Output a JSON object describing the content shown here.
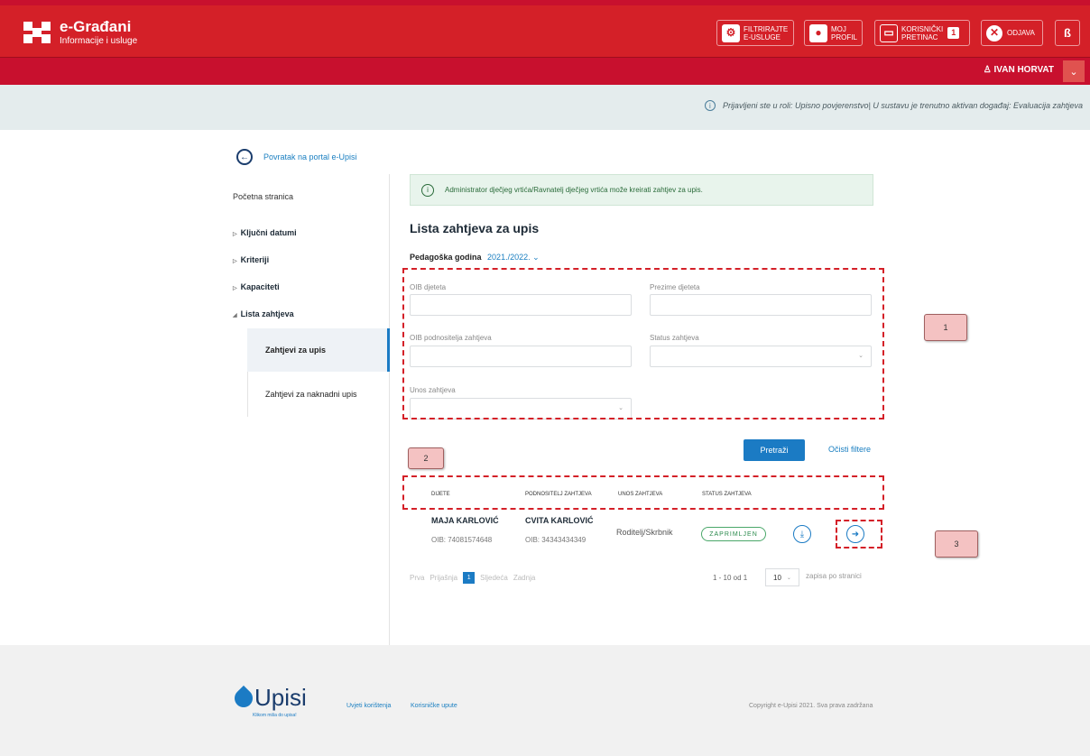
{
  "header": {
    "brand_title": "e-Građani",
    "brand_sub": "Informacije i usluge",
    "btn_filter_l1": "FILTRIRAJTE",
    "btn_filter_l2": "E-USLUGE",
    "btn_profile_l1": "MOJ",
    "btn_profile_l2": "PROFIL",
    "btn_inbox_l1": "KORISNIČKI",
    "btn_inbox_l2": "PRETINAC",
    "inbox_count": "1",
    "btn_logout": "ODJAVA",
    "lang_btn": "ß",
    "user_name": "IVAN HORVAT"
  },
  "infobar": {
    "text": "Prijavljeni ste u roli: Upisno povjerenstvo| U sustavu je trenutno aktivan događaj: Evaluacija zahtjeva"
  },
  "sidebar": {
    "back_link": "Povratak na portal e-Upisi",
    "home": "Početna stranica",
    "sections": [
      "Ključni datumi",
      "Kriteriji",
      "Kapaciteti",
      "Lista zahtjeva"
    ],
    "sub_items": [
      "Zahtjevi za upis",
      "Zahtjevi za naknadni upis"
    ]
  },
  "main": {
    "alert": "Administrator dječjeg vrtića/Ravnatelj dječjeg vrtića može kreirati zahtjev za upis.",
    "title": "Lista zahtjeva za upis",
    "year_label": "Pedagoška godina",
    "year_value": "2021./2022.",
    "filters": {
      "oib_child": "OIB djeteta",
      "surname_child": "Prezime djeteta",
      "oib_applicant": "OIB podnositelja zahtjeva",
      "status": "Status zahtjeva",
      "entry": "Unos zahtjeva"
    },
    "search_btn": "Pretraži",
    "clear_link": "Očisti filtere",
    "columns": [
      "DIJETE",
      "PODNOSITELJ ZAHTJEVA",
      "UNOS ZAHTJEVA",
      "STATUS ZAHTJEVA"
    ],
    "row": {
      "child_name": "MAJA KARLOVIĆ",
      "child_oib": "OIB: 74081574648",
      "applicant_name": "CVITA KARLOVIĆ",
      "applicant_oib": "OIB: 34343434349",
      "entry": "Roditelj/Skrbnik",
      "status": "ZAPRIMLJEN"
    },
    "pager": {
      "first": "Prva",
      "prev": "Prijašnja",
      "current": "1",
      "next": "Sljedeća",
      "last": "Zadnja",
      "info": "1 - 10 od 1",
      "per_page": "10",
      "per_page_label": "zapisa po stranici"
    }
  },
  "callouts": [
    "1",
    "2",
    "3"
  ],
  "footer": {
    "logo_text": "Upisi",
    "tagline": "Klikom miša do upisa!",
    "link_terms": "Uvjeti korištenja",
    "link_manual": "Korisničke upute",
    "copyright": "Copyright e-Upisi 2021. Sva prava zadržana"
  },
  "colors": {
    "brand_red": "#d42028",
    "accent_blue": "#1b7bc4",
    "status_green": "#4aa86a"
  },
  "icons": [
    "gov-logo-icon",
    "filter-icon",
    "profile-icon",
    "inbox-icon",
    "close-icon",
    "user-icon",
    "chevron-down-icon",
    "info-icon",
    "arrow-left-icon",
    "download-icon",
    "arrow-right-icon"
  ]
}
